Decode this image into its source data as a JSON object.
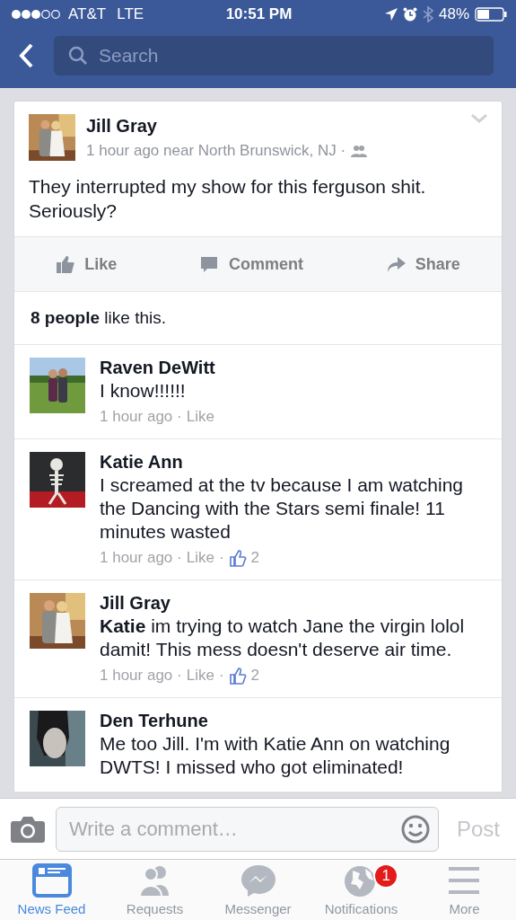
{
  "status_bar": {
    "carrier": "AT&T",
    "network": "LTE",
    "time": "10:51 PM",
    "battery": "48%"
  },
  "nav": {
    "search": {
      "placeholder": "Search"
    }
  },
  "post": {
    "author": "Jill Gray",
    "meta": "1 hour ago near North Brunswick, NJ ·",
    "text": "They interrupted my show for this ferguson shit. Seriously?",
    "actions": [
      {
        "kind": "like",
        "label": "Like"
      },
      {
        "kind": "comment",
        "label": "Comment"
      },
      {
        "kind": "share",
        "label": "Share"
      }
    ],
    "likes": "**8 people** like this."
  },
  "comments": [
    {
      "author": "Raven DeWitt",
      "text": "I know!!!!!!",
      "time": "1 hour ago ·",
      "like": "Like"
    },
    {
      "author": "Katie Ann",
      "text": "I screamed at the tv because I am watching the Dancing with the Stars semi finale! 11 minutes wasted",
      "time": "1 hour ago ·",
      "like": "Like",
      "like_sep": "·",
      "like_count": "2"
    },
    {
      "author": "Jill Gray",
      "text": "**Katie** im trying to watch Jane the virgin lolol damit! This mess doesn't deserve air time.",
      "time": "1 hour ago ·",
      "like": "Like",
      "like_sep": "·",
      "like_count": "2"
    },
    {
      "author": "Den Terhune",
      "text": "Me too Jill. I'm with Katie Ann on watching DWTS! I missed who got eliminated!"
    }
  ],
  "composer": {
    "placeholder": "Write a comment…",
    "post": {
      "label": "Post",
      "disabled": true
    }
  },
  "tabs": [
    {
      "kind": "feed",
      "label": "News Feed",
      "selected": true
    },
    {
      "kind": "requests",
      "label": "Requests",
      "selected": false
    },
    {
      "kind": "messenger",
      "label": "Messenger",
      "selected": false
    },
    {
      "kind": "notifications",
      "label": "Notifications",
      "selected": false,
      "badge": "1"
    },
    {
      "kind": "more",
      "label": "More",
      "selected": false
    }
  ]
}
